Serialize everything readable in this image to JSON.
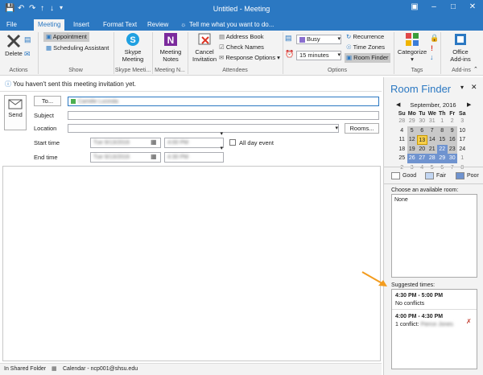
{
  "window": {
    "title": "Untitled  -  Meeting"
  },
  "tabs": [
    "File",
    "Meeting",
    "Insert",
    "Format Text",
    "Review"
  ],
  "tell_me": "Tell me what you want to do...",
  "ribbon": {
    "delete": "Delete",
    "appointment": "Appointment",
    "scheduling": "Scheduling Assistant",
    "skype": [
      "Skype",
      "Meeting"
    ],
    "notes": [
      "Meeting",
      "Notes"
    ],
    "cancel": [
      "Cancel",
      "Invitation"
    ],
    "address_book": "Address Book",
    "check_names": "Check Names",
    "response": "Response Options",
    "busy": "Busy",
    "reminder": "15 minutes",
    "recurrence": "Recurrence",
    "time_zones": "Time Zones",
    "room_finder": "Room Finder",
    "categorize": "Categorize",
    "office": [
      "Office",
      "Add-ins"
    ],
    "groups": {
      "actions": "Actions",
      "show": "Show",
      "skype": "Skype Meeti...",
      "notes": "Meeting N...",
      "attendees": "Attendees",
      "options": "Options",
      "tags": "Tags",
      "addins": "Add-ins"
    }
  },
  "info": "You haven't sent this meeting invitation yet.",
  "form": {
    "send": "Send",
    "to": "To...",
    "to_value": "Camille Lucinda",
    "subject": "Subject",
    "location": "Location",
    "rooms": "Rooms...",
    "start": "Start time",
    "end": "End time",
    "start_date": "Tue 9/13/2016",
    "start_time": "4:00 PM",
    "end_date": "Tue 9/13/2016",
    "end_time": "4:30 PM",
    "all_day": "All day event"
  },
  "status": {
    "left": "In Shared Folder",
    "calendar": "Calendar - ncp001@shsu.edu"
  },
  "room_finder": {
    "title": "Room Finder",
    "month": "September, 2016",
    "dow": [
      "Su",
      "Mo",
      "Tu",
      "We",
      "Th",
      "Fr",
      "Sa"
    ],
    "weeks": [
      [
        "28",
        "29",
        "30",
        "31",
        "1",
        "2",
        "3"
      ],
      [
        "4",
        "5",
        "6",
        "7",
        "8",
        "9",
        "10"
      ],
      [
        "11",
        "12",
        "13",
        "14",
        "15",
        "16",
        "17"
      ],
      [
        "18",
        "19",
        "20",
        "21",
        "22",
        "23",
        "24"
      ],
      [
        "25",
        "26",
        "27",
        "28",
        "29",
        "30",
        "1"
      ],
      [
        "2",
        "3",
        "4",
        "5",
        "6",
        "7",
        "8"
      ]
    ],
    "legend": [
      "Good",
      "Fair",
      "Poor"
    ],
    "choose_label": "Choose an available room:",
    "room": "None",
    "suggested_label": "Suggested times:",
    "suggestions": [
      {
        "time": "4:30 PM - 5:00 PM",
        "detail": "No conflicts"
      },
      {
        "time": "4:00 PM - 4:30 PM",
        "detail": "1 conflict:",
        "who": "Pierce Jones"
      }
    ]
  }
}
